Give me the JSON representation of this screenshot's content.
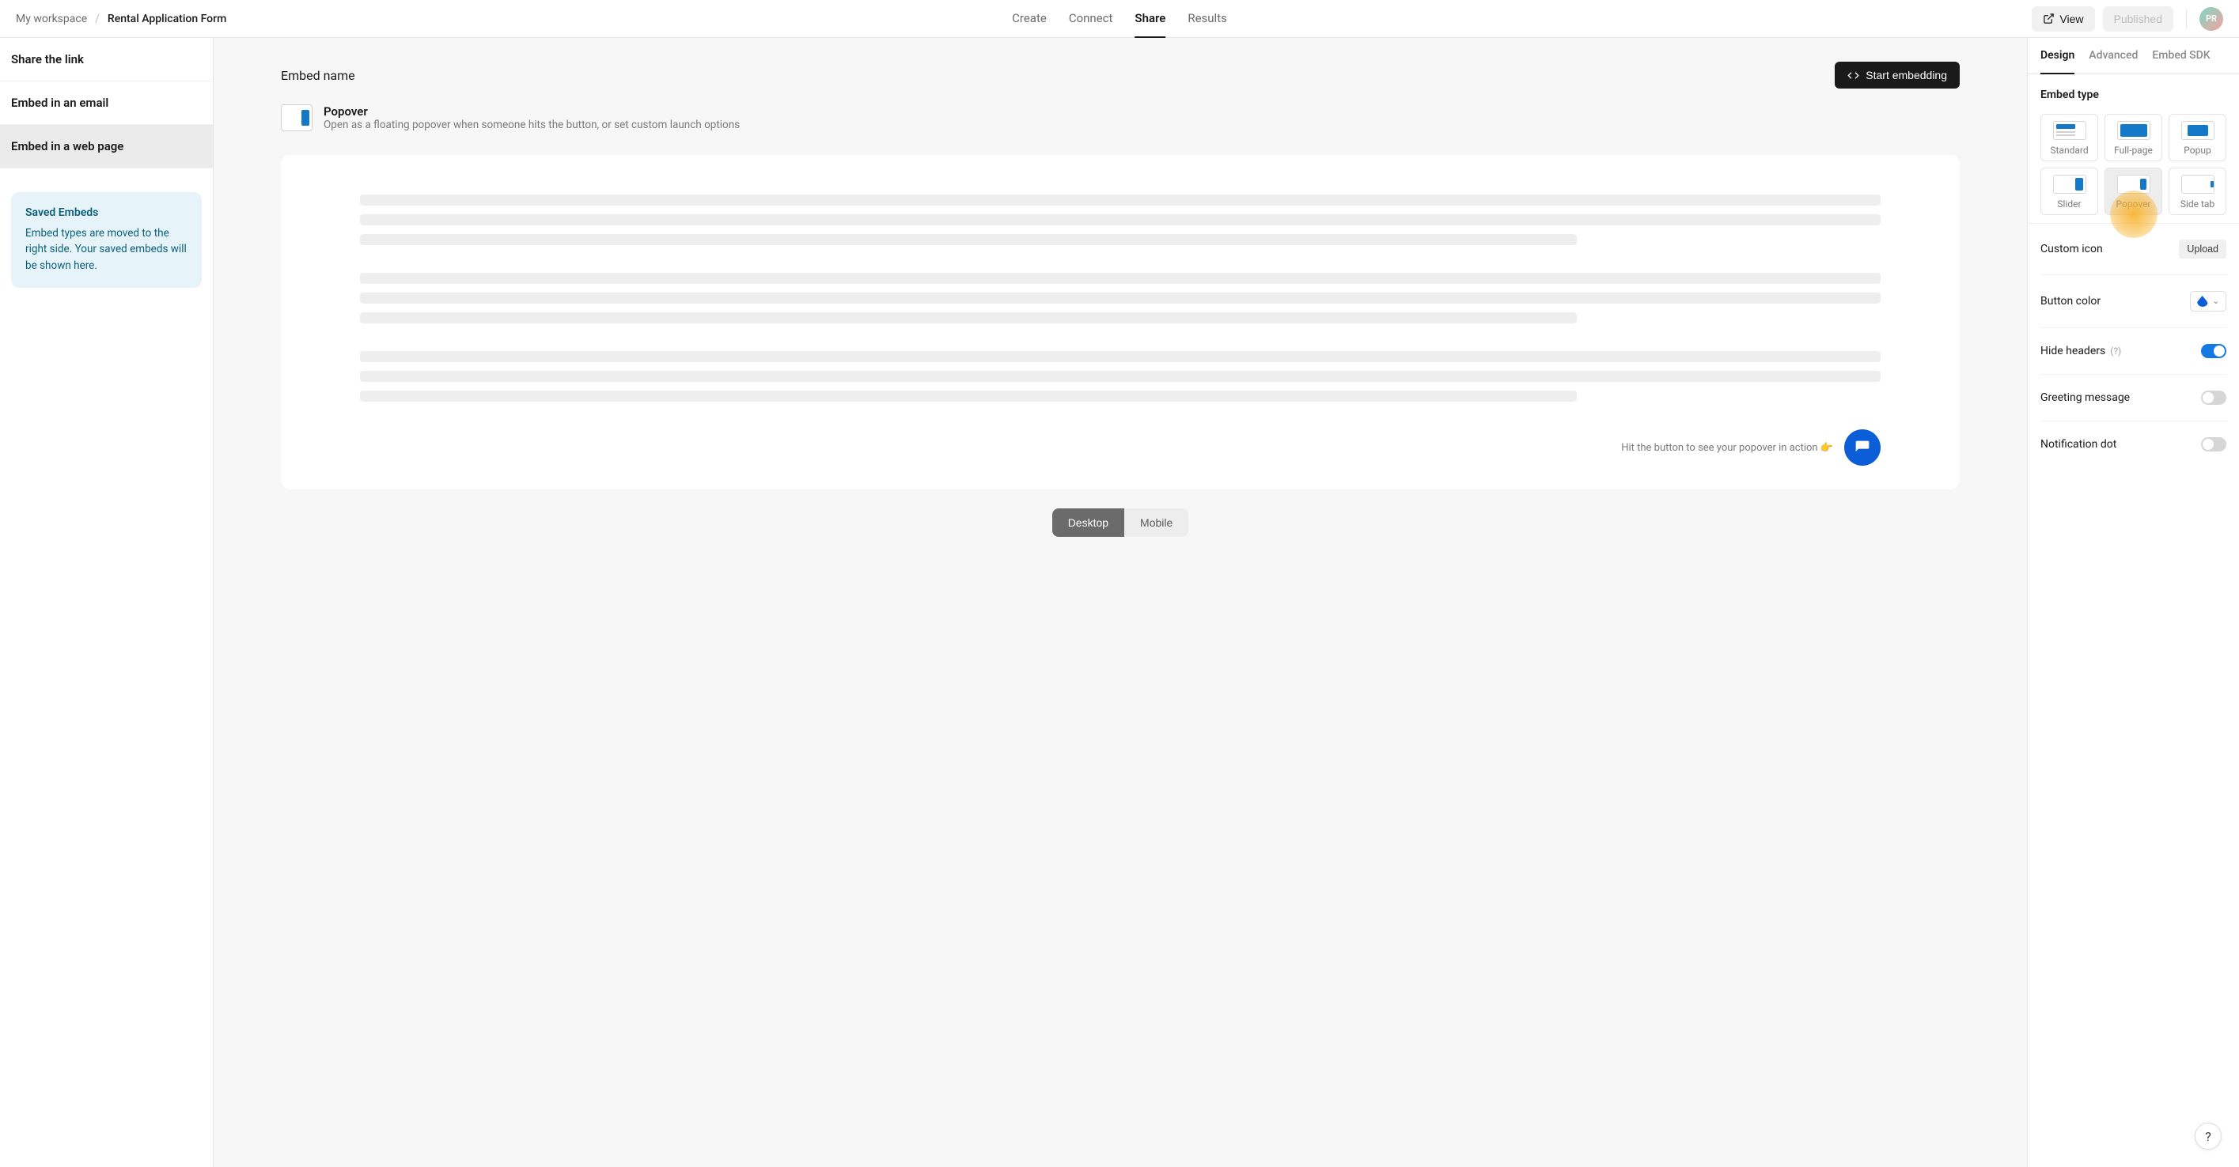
{
  "header": {
    "workspace": "My workspace",
    "sep": "/",
    "current": "Rental Application Form",
    "tabs": [
      "Create",
      "Connect",
      "Share",
      "Results"
    ],
    "active_tab": "Share",
    "view_label": "View",
    "published_label": "Published",
    "avatar_initials": "PR"
  },
  "sidebar": {
    "items": [
      "Share the link",
      "Embed in an email",
      "Embed in a web page"
    ],
    "active_index": 2,
    "saved": {
      "title": "Saved Embeds",
      "desc": "Embed types are moved to the right side. Your saved embeds will be shown here."
    }
  },
  "center": {
    "embed_name_label": "Embed name",
    "start_label": "Start embedding",
    "embed_title": "Popover",
    "embed_sub": "Open as a floating popover when someone hits the button, or set custom launch options",
    "hint": "Hit the button to see your popover in action 👉",
    "device_toggle": {
      "options": [
        "Desktop",
        "Mobile"
      ],
      "active": "Desktop"
    }
  },
  "right": {
    "tabs": [
      "Design",
      "Advanced",
      "Embed SDK"
    ],
    "active_tab": "Design",
    "embed_type_label": "Embed type",
    "types": [
      "Standard",
      "Full-page",
      "Popup",
      "Slider",
      "Popover",
      "Side tab"
    ],
    "selected_type": "Popover",
    "settings": {
      "custom_icon": {
        "label": "Custom icon",
        "action": "Upload"
      },
      "button_color": {
        "label": "Button color",
        "value": "#0b5ed7"
      },
      "hide_headers": {
        "label": "Hide headers",
        "help": "(?)",
        "on": true
      },
      "greeting": {
        "label": "Greeting message",
        "on": false
      },
      "notification": {
        "label": "Notification dot",
        "on": false
      }
    }
  },
  "help": "?"
}
